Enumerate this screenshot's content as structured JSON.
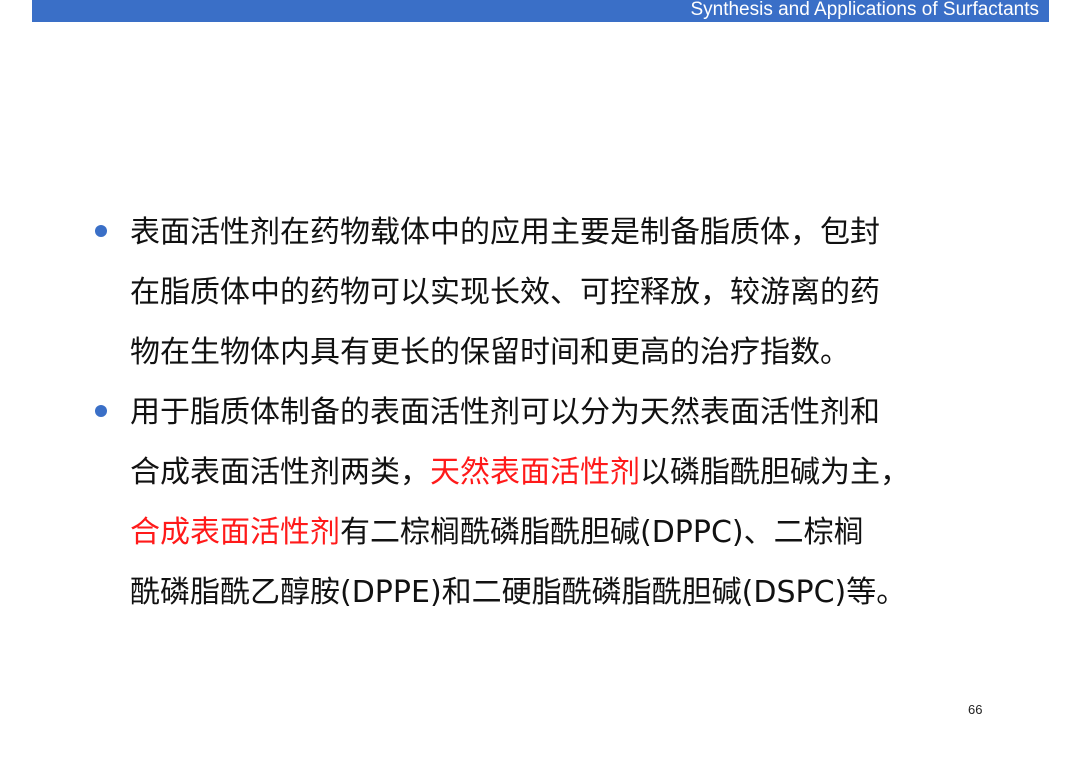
{
  "header": {
    "title": "Synthesis and Applications of Surfactants",
    "bar_color": "#3a6fc7"
  },
  "bullets": [
    {
      "lines": [
        "表面活性剂在药物载体中的应用主要是制备脂质体，包封",
        "在脂质体中的药物可以实现长效、可控释放，较游离的药",
        "物在生物体内具有更长的保留时间和更高的治疗指数。"
      ]
    },
    {
      "line1": "用于脂质体制备的表面活性剂可以分为天然表面活性剂和",
      "line2_a": "合成表面活性剂两类，",
      "line2_b_highlight": "天然表面活性剂",
      "line2_c": "以磷脂酰胆碱为主，",
      "line3_a_highlight": "合成表面活性剂",
      "line3_b": "有二棕榈酰磷脂酰胆碱(DPPC)、二棕榈",
      "line4": "酰磷脂酰乙醇胺(DPPE)和二硬脂酰磷脂酰胆碱(DSPC)等。"
    }
  ],
  "highlight_color": "#ff1a1a",
  "page_number": "66"
}
